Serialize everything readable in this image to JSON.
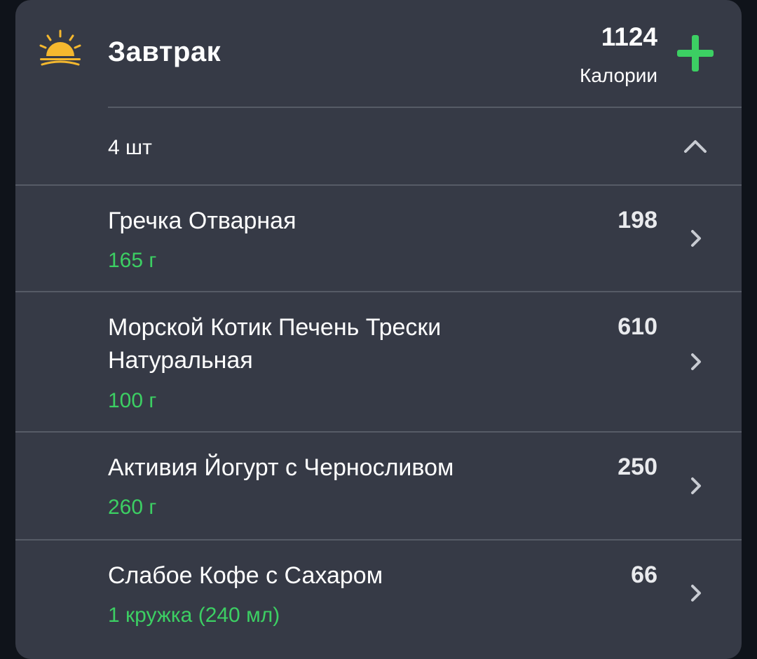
{
  "meal": {
    "title": "Завтрак",
    "icon": "sunrise-icon",
    "total_calories": "1124",
    "calories_label": "Калории",
    "item_count": "4 шт"
  },
  "colors": {
    "card_background": "#363a46",
    "page_background": "#0f131a",
    "accent_green": "#3ccf63",
    "sun_yellow": "#f5b82e"
  },
  "items": [
    {
      "name": "Гречка Отварная",
      "amount": "165 г",
      "calories": "198"
    },
    {
      "name": "Морской Котик Печень Трески Натуральная",
      "amount": "100 г",
      "calories": "610"
    },
    {
      "name": "Активия Йогурт с Черносливом",
      "amount": "260 г",
      "calories": "250"
    },
    {
      "name": "Слабое Кофе с Сахаром",
      "amount": "1 кружка (240 мл)",
      "calories": "66"
    }
  ]
}
